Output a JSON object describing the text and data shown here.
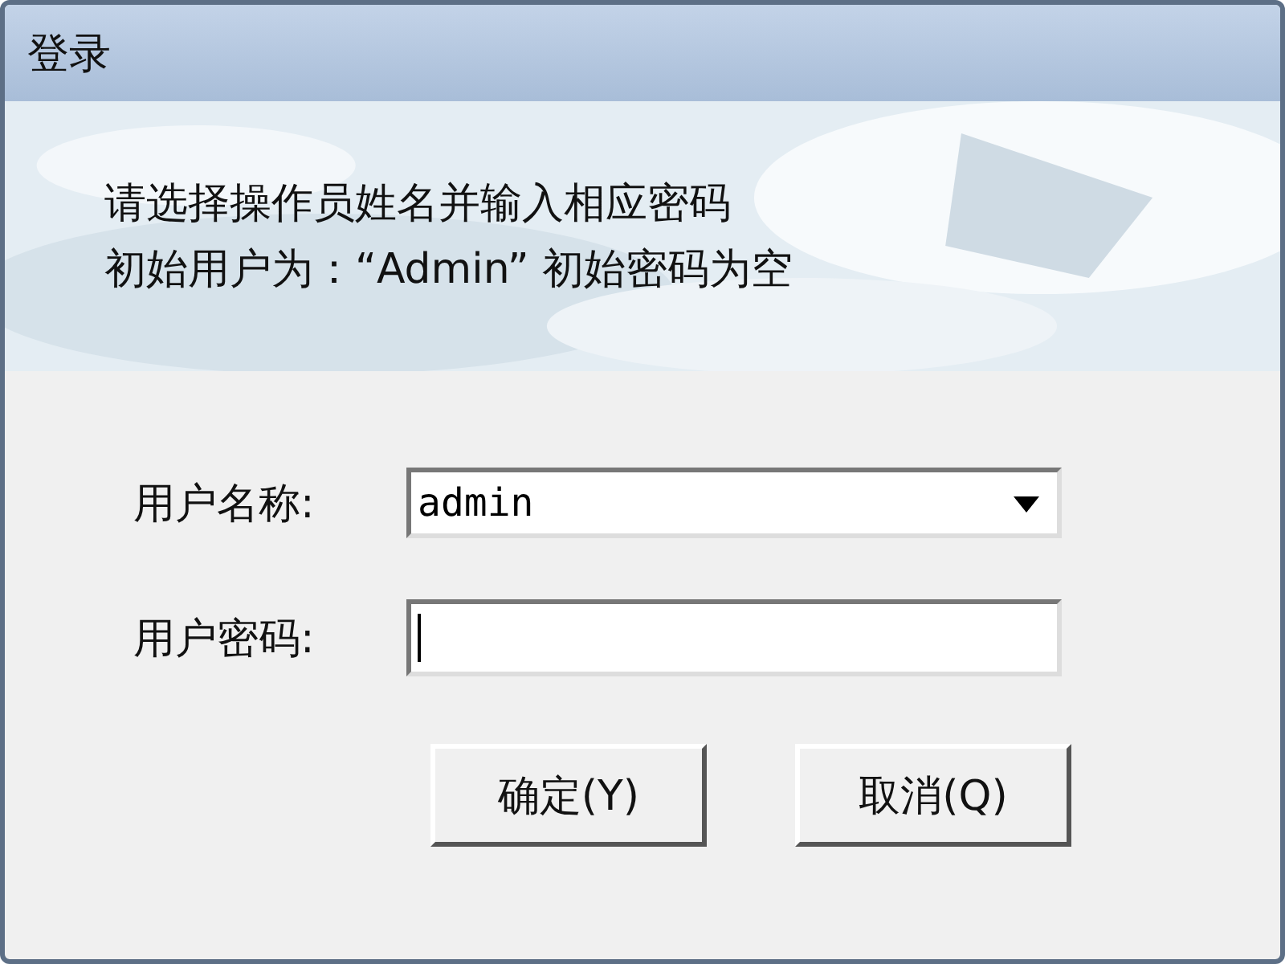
{
  "window": {
    "title": "登录"
  },
  "instructions": [
    "请选择操作员姓名并输入相应密码",
    "初始用户为：“Admin” 初始密码为空"
  ],
  "fields": [
    {
      "label": "用户名称:",
      "kind": "combo",
      "value": "admin"
    },
    {
      "label": "用户密码:",
      "kind": "password"
    }
  ],
  "buttons": [
    "确定(Y)",
    "取消(Q)"
  ]
}
